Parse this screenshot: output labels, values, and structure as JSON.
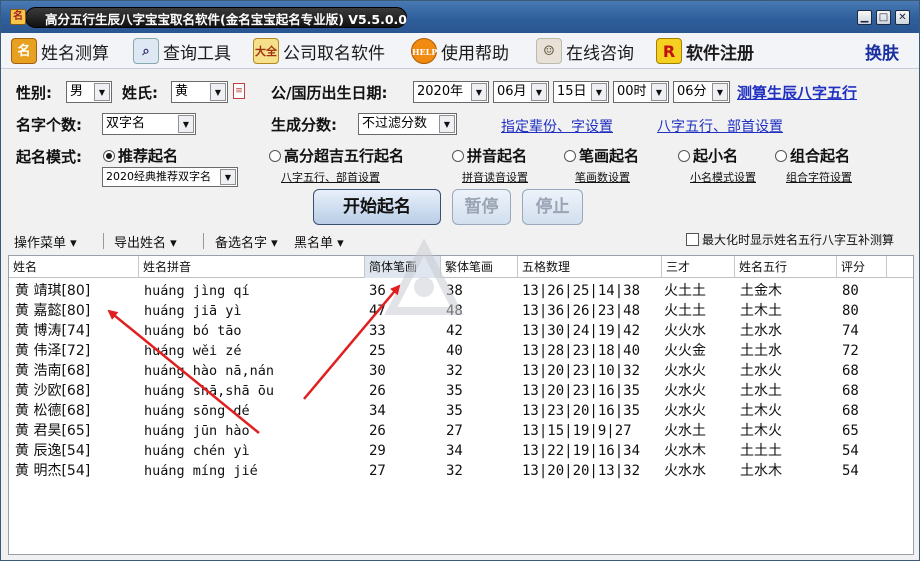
{
  "window": {
    "title": "高分五行生辰八字宝宝取名软件(金名宝宝起名专业版) V5.5.0.0",
    "app_icon_glyph": "名"
  },
  "toolbar": {
    "items": [
      {
        "icon": "naming-icon",
        "label": "姓名测算"
      },
      {
        "icon": "magnifier-icon",
        "label": "查询工具"
      },
      {
        "icon": "book-icon",
        "label": "公司取名软件"
      },
      {
        "icon": "help-icon",
        "label": "使用帮助"
      },
      {
        "icon": "operator-icon",
        "label": "在线咨询"
      },
      {
        "icon": "register-icon",
        "label": "软件注册"
      }
    ],
    "help_text": "HELP",
    "register_letter": "R",
    "skin_label": "换肤"
  },
  "form": {
    "gender_label": "性别:",
    "gender_value": "男",
    "surname_label": "姓氏:",
    "surname_value": "黄",
    "birth_label": "公/国历出生日期:",
    "year": "2020年",
    "month": "06月",
    "day": "15日",
    "hour": "00时",
    "minute": "06分",
    "calc_link": "测算生辰八字五行",
    "count_label": "名字个数:",
    "count_value": "双字名",
    "score_label": "生成分数:",
    "score_value": "不过滤分数",
    "gen_link": "指定辈份、字设置",
    "bazi_link": "八字五行、部首设置",
    "mode_label": "起名模式:",
    "modes": [
      {
        "label": "推荐起名",
        "checked": true
      },
      {
        "label": "高分超吉五行起名",
        "checked": false
      },
      {
        "label": "拼音起名",
        "checked": false
      },
      {
        "label": "笔画起名",
        "checked": false
      },
      {
        "label": "起小名",
        "checked": false
      },
      {
        "label": "组合起名",
        "checked": false
      }
    ],
    "recommend_value": "2020经典推荐双字名",
    "sub_links": [
      "八字五行、部首设置",
      "拼音读音设置",
      "笔画数设置",
      "小名模式设置",
      "组合字符设置"
    ],
    "start_button": "开始起名",
    "pause_button": "暂停",
    "stop_button": "停止"
  },
  "menubar": {
    "items": [
      "操作菜单",
      "导出姓名",
      "备选名字",
      "黑名单"
    ],
    "checkbox_label": "最大化时显示姓名五行八字互补测算"
  },
  "table": {
    "columns": [
      "姓名",
      "姓名拼音",
      "简体笔画",
      "繁体笔画",
      "五格数理",
      "三才",
      "姓名五行",
      "评分"
    ],
    "rows": [
      [
        "黄 靖琪[80]",
        "huáng jìng qí",
        "36",
        "38",
        "13|26|25|14|38",
        "火土土",
        "土金木",
        "80"
      ],
      [
        "黄 嘉懿[80]",
        "huáng jiā yì",
        "47",
        "48",
        "13|36|26|23|48",
        "火土土",
        "土木土",
        "80"
      ],
      [
        "黄 博涛[74]",
        "huáng bó tāo",
        "33",
        "42",
        "13|30|24|19|42",
        "火火水",
        "土水水",
        "74"
      ],
      [
        "黄 伟泽[72]",
        "huáng wěi zé",
        "25",
        "40",
        "13|28|23|18|40",
        "火火金",
        "土土水",
        "72"
      ],
      [
        "黄 浩南[68]",
        "huáng hào nā,nán",
        "30",
        "32",
        "13|20|23|10|32",
        "火水火",
        "土水火",
        "68"
      ],
      [
        "黄 沙欧[68]",
        "huáng shā,shā ōu",
        "26",
        "35",
        "13|20|23|16|35",
        "火水火",
        "土水土",
        "68"
      ],
      [
        "黄 松德[68]",
        "huáng sōng dé",
        "34",
        "35",
        "13|23|20|16|35",
        "火水火",
        "土木火",
        "68"
      ],
      [
        "黄 君昊[65]",
        "huáng jūn hào",
        "26",
        "27",
        "13|15|19|9|27",
        "火水土",
        "土木火",
        "65"
      ],
      [
        "黄 辰逸[54]",
        "huáng chén yì",
        "29",
        "34",
        "13|22|19|16|34",
        "火水木",
        "土土土",
        "54"
      ],
      [
        "黄 明杰[54]",
        "huáng míng jié",
        "27",
        "32",
        "13|20|20|13|32",
        "火水水",
        "土水木",
        "54"
      ]
    ]
  },
  "colors": {
    "title_bar": "#2f5f9c",
    "link": "#2030c0",
    "annotation_arrow": "#e02020"
  }
}
